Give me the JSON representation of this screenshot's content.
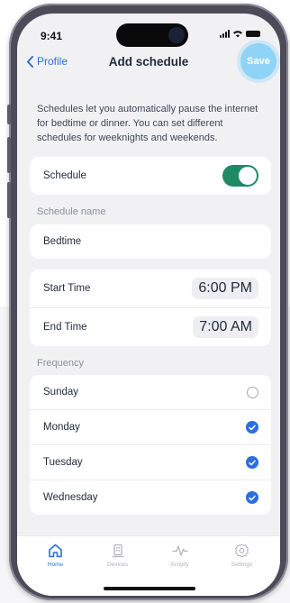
{
  "status_bar": {
    "time": "9:41"
  },
  "nav": {
    "back_label": "Profile",
    "title": "Add schedule",
    "save_label": "Save"
  },
  "intro_text": "Schedules let you automatically pause the internet for bedtime or dinner. You can set different schedules for weeknights and weekends.",
  "schedule_toggle": {
    "label": "Schedule",
    "enabled": true
  },
  "schedule_name": {
    "section_label": "Schedule name",
    "value": "Bedtime"
  },
  "times": {
    "start_label": "Start Time",
    "start_value": "6:00 PM",
    "end_label": "End Time",
    "end_value": "7:00 AM"
  },
  "frequency": {
    "section_label": "Frequency",
    "days": [
      {
        "label": "Sunday",
        "selected": false
      },
      {
        "label": "Monday",
        "selected": true
      },
      {
        "label": "Tuesday",
        "selected": true
      },
      {
        "label": "Wednesday",
        "selected": true
      }
    ]
  },
  "tab_bar": {
    "tabs": [
      {
        "label": "Home",
        "icon": "home-icon",
        "active": true
      },
      {
        "label": "Devices",
        "icon": "devices-icon",
        "active": false
      },
      {
        "label": "Activity",
        "icon": "activity-icon",
        "active": false
      },
      {
        "label": "Settings",
        "icon": "settings-icon",
        "active": false
      }
    ]
  },
  "colors": {
    "accent": "#2c6fdc",
    "toggle_on": "#1d8a64",
    "save_button": "#8fd3f6",
    "back_link": "#2f6fd0"
  }
}
